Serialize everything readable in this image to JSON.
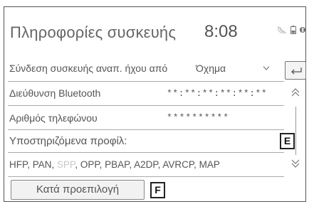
{
  "header": {
    "title": "Πληροφορίες συσκευής",
    "clock": "8:08",
    "status_icons": [
      "phone-disconnected-icon",
      "battery-icon",
      "bluetooth-icon"
    ]
  },
  "source": {
    "label": "Σύνδεση συσκευής αναπ. ήχου από",
    "value": "Όχημα"
  },
  "bluetooth": {
    "label": "Διεύθυνση Bluetooth",
    "value": "**:**:**:**:**:**"
  },
  "phone": {
    "label": "Αριθμός τηλεφώνου",
    "value": "**********"
  },
  "profiles": {
    "label": "Υποστηριζόμενα προφίλ:",
    "items": [
      {
        "text": "HFP, PAN, ",
        "active": true
      },
      {
        "text": "SPP",
        "active": false
      },
      {
        "text": ", OPP, PBAP, A2DP, AVRCP, MAP",
        "active": true
      }
    ]
  },
  "default_button": {
    "label": "Κατά προεπιλογή"
  },
  "callouts": {
    "e": "E",
    "f": "F"
  }
}
